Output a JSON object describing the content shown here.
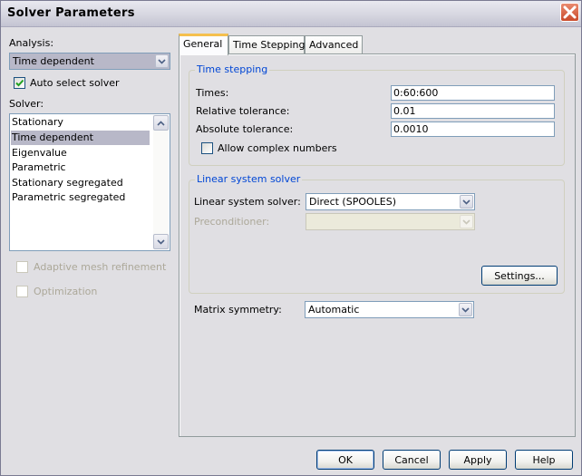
{
  "window": {
    "title": "Solver Parameters",
    "close_icon": "close-icon"
  },
  "left": {
    "analysis_label": "Analysis:",
    "analysis_value": "Time dependent",
    "auto_select_label": "Auto select solver",
    "auto_select_checked": true,
    "solver_label": "Solver:",
    "solver_items": [
      {
        "label": "Stationary",
        "selected": false
      },
      {
        "label": "Time dependent",
        "selected": true
      },
      {
        "label": "Eigenvalue",
        "selected": false
      },
      {
        "label": "Parametric",
        "selected": false
      },
      {
        "label": "Stationary segregated",
        "selected": false
      },
      {
        "label": "Parametric segregated",
        "selected": false
      }
    ],
    "adaptive_label": "Adaptive mesh refinement",
    "adaptive_checked": false,
    "optimization_label": "Optimization",
    "optimization_checked": false
  },
  "tabs": [
    {
      "label": "General",
      "active": true
    },
    {
      "label": "Time Stepping",
      "active": false
    },
    {
      "label": "Advanced",
      "active": false
    }
  ],
  "general": {
    "time_stepping": {
      "title": "Time stepping",
      "times_label": "Times:",
      "times_value": "0:60:600",
      "rel_tol_label": "Relative tolerance:",
      "rel_tol_value": "0.01",
      "abs_tol_label": "Absolute tolerance:",
      "abs_tol_value": "0.0010",
      "complex_label": "Allow complex numbers",
      "complex_checked": false
    },
    "linear_solver": {
      "title": "Linear system solver",
      "solver_label": "Linear system solver:",
      "solver_value": "Direct (SPOOLES)",
      "preconditioner_label": "Preconditioner:",
      "preconditioner_value": "",
      "settings_button": "Settings..."
    },
    "matrix_symmetry_label": "Matrix symmetry:",
    "matrix_symmetry_value": "Automatic"
  },
  "buttons": {
    "ok": "OK",
    "cancel": "Cancel",
    "apply": "Apply",
    "help": "Help"
  }
}
